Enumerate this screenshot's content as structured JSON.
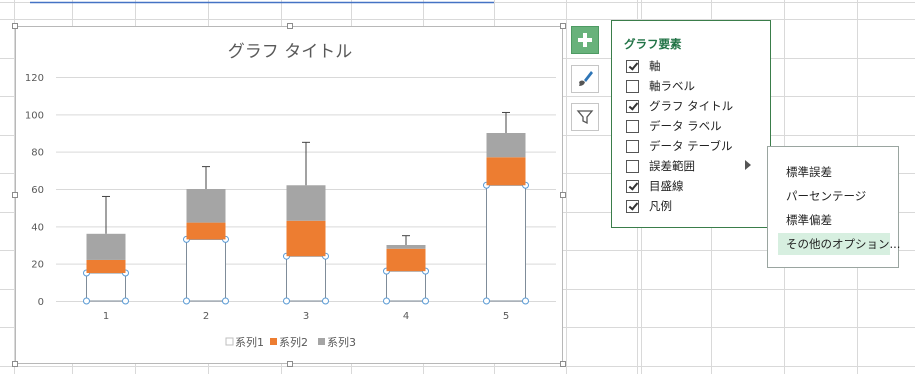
{
  "chart": {
    "title": "グラフ タイトル"
  },
  "chart_data": {
    "type": "bar",
    "stacked": true,
    "categories": [
      "1",
      "2",
      "3",
      "4",
      "5"
    ],
    "series": [
      {
        "name": "系列1",
        "values": [
          15,
          33,
          24,
          16,
          62
        ],
        "color": "#ffffff"
      },
      {
        "name": "系列2",
        "values": [
          7,
          9,
          19,
          12,
          15
        ],
        "color": "#ed7d31"
      },
      {
        "name": "系列3",
        "values": [
          14,
          18,
          19,
          2,
          13
        ],
        "color": "#a5a5a5"
      }
    ],
    "error_bar_tops": [
      56,
      72,
      85,
      35,
      101
    ],
    "ylim": [
      0,
      120
    ],
    "yticks": [
      0,
      20,
      40,
      60,
      80,
      100,
      120
    ],
    "grid": true,
    "legend": "bottom",
    "xlabel": "",
    "ylabel": ""
  },
  "chart_elements_panel": {
    "title": "グラフ要素",
    "items": [
      {
        "label": "軸",
        "checked": true
      },
      {
        "label": "軸ラベル",
        "checked": false
      },
      {
        "label": "グラフ タイトル",
        "checked": true
      },
      {
        "label": "データ ラベル",
        "checked": false
      },
      {
        "label": "データ テーブル",
        "checked": false
      },
      {
        "label": "誤差範囲",
        "checked": false
      },
      {
        "label": "目盛線",
        "checked": true
      },
      {
        "label": "凡例",
        "checked": true
      }
    ]
  },
  "error_bar_submenu": {
    "items": [
      "標準誤差",
      "パーセンテージ",
      "標準偏差",
      "その他のオプション..."
    ]
  },
  "colors": {
    "accent_green": "#217346",
    "button_green": "#68b27b",
    "series2_orange": "#ed7d31",
    "series3_gray": "#a5a5a5",
    "selection_blue": "#5b9bd5"
  }
}
